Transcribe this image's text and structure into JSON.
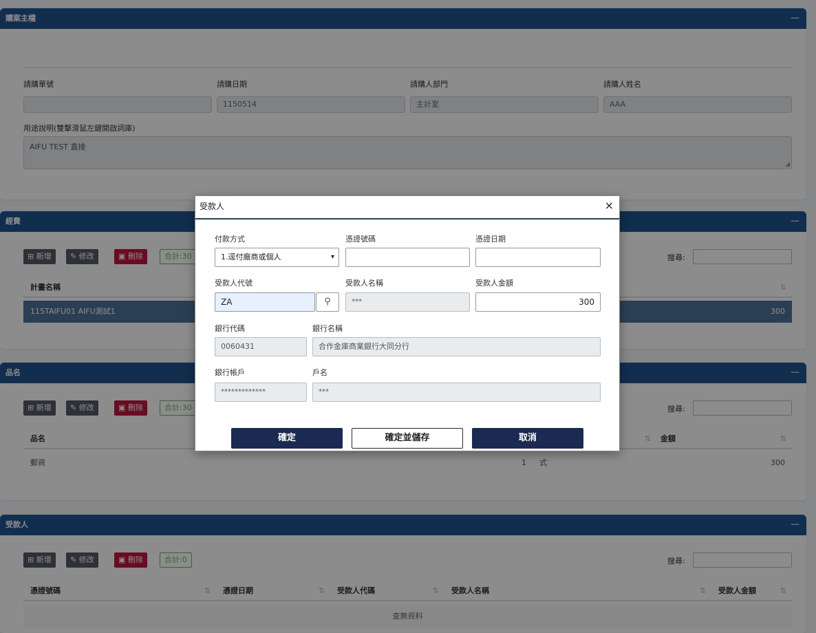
{
  "panel_master": {
    "title": "購案主檔",
    "collapse": "—",
    "labels": {
      "po_no": "請購單號",
      "po_date": "請購日期",
      "dept": "請購人部門",
      "name": "請購人姓名"
    },
    "values": {
      "po_no": "",
      "po_date": "1150514",
      "dept": "主計室",
      "name": "AAA"
    },
    "purpose_label": "用途說明(雙擊滑鼠左鍵開啟詞庫)",
    "purpose_value": "AIFU TEST 直接"
  },
  "panel_funding": {
    "title": "經費",
    "collapse": "—",
    "toolbar": {
      "add": "新增",
      "edit": "修改",
      "delete": "刪除",
      "count": "合計:30"
    },
    "search_label": "搜尋:",
    "columns": {
      "plan": "計畫名稱"
    },
    "row": {
      "plan": "115TAIFU01 AIFU測試1",
      "amount": "300"
    }
  },
  "panel_items": {
    "title": "品名",
    "collapse": "—",
    "toolbar": {
      "add": "新增",
      "edit": "修改",
      "delete": "刪除",
      "count": "合計:30"
    },
    "search_label": "搜尋:",
    "columns": {
      "item": "品名",
      "amount": "金額"
    },
    "row": {
      "item": "郵資",
      "qty": "1",
      "unit": "式",
      "amount": "300"
    }
  },
  "panel_payee": {
    "title": "受款人",
    "collapse": "—",
    "toolbar": {
      "add": "新增",
      "edit": "修改",
      "delete": "刪除",
      "count": "合計:0"
    },
    "search_label": "搜尋:",
    "columns": {
      "voucher_no": "憑證號碼",
      "voucher_date": "憑證日期",
      "payee_code": "受款人代碼",
      "payee_name": "受款人名稱",
      "payee_amount": "受款人金額"
    },
    "empty": "查無資料"
  },
  "modal": {
    "title": "受款人",
    "close": "×",
    "labels": {
      "pay_method": "付款方式",
      "voucher_no": "憑證號碼",
      "voucher_date": "憑證日期",
      "payee_code": "受款人代號",
      "payee_name": "受款人名稱",
      "payee_amount": "受款人金額",
      "bank_code": "銀行代碼",
      "bank_name": "銀行名稱",
      "bank_account": "銀行帳戶",
      "account_name": "戶名"
    },
    "values": {
      "pay_method": "1.逕付廠商或個人",
      "voucher_no": "",
      "voucher_date": "",
      "payee_code": "ZA",
      "payee_name": "***",
      "payee_amount": "300",
      "bank_code": "0060431",
      "bank_name": "合作金庫商業銀行大同分行",
      "bank_account": "*************",
      "account_name": "***"
    },
    "buttons": {
      "confirm": "確定",
      "confirm_save": "確定並儲存",
      "cancel": "取消"
    }
  },
  "icons": {
    "sort": "⇅",
    "search": "magnifier-icon",
    "chevron": "chevron-down-icon"
  },
  "colors": {
    "header": "#1f5591",
    "selected_row": "#4f7399",
    "delete": "#c0143c",
    "modal_btn": "#1b2a52"
  }
}
